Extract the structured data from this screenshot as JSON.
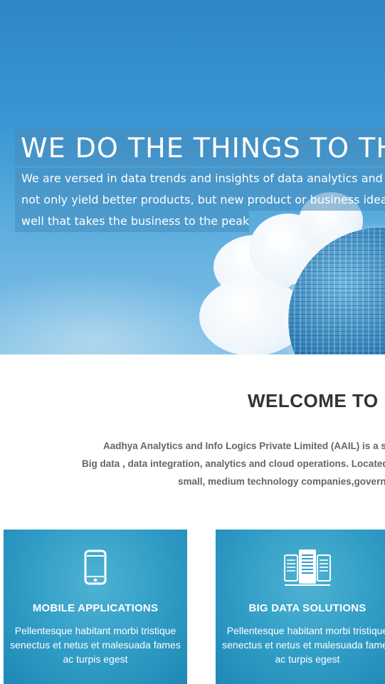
{
  "hero": {
    "title": "WE DO THE THINGS TO THE",
    "lines": [
      "We are versed in data trends and insights of data analytics and cloud",
      "not only yield better products, but new product or business ideas as",
      "well that takes the business to the peaks."
    ]
  },
  "welcome": {
    "title": "WELCOME TO",
    "lines": [
      "Aadhya Analytics and Info Logics Private Limited (AAIL) is a so",
      "Big data , data integration, analytics and cloud operations. Located i",
      "small, medium technology companies,governm"
    ]
  },
  "cards": [
    {
      "icon": "mobile-phone-icon",
      "title": "MOBILE APPLICATIONS",
      "text": "Pellentesque habitant morbi tristique senectus et netus et malesuada fames ac turpis egest"
    },
    {
      "icon": "server-stack-icon",
      "title": "BIG DATA SOLUTIONS",
      "text": "Pellentesque habitant morbi tristique senectus et netus et malesuada fames ac turpis egest"
    }
  ],
  "colors": {
    "hero_sky": "#3a97d3",
    "hero_box": "#468cbe",
    "card_bg": "#2f9cc5",
    "heading": "#333333",
    "body_text": "#666666"
  }
}
